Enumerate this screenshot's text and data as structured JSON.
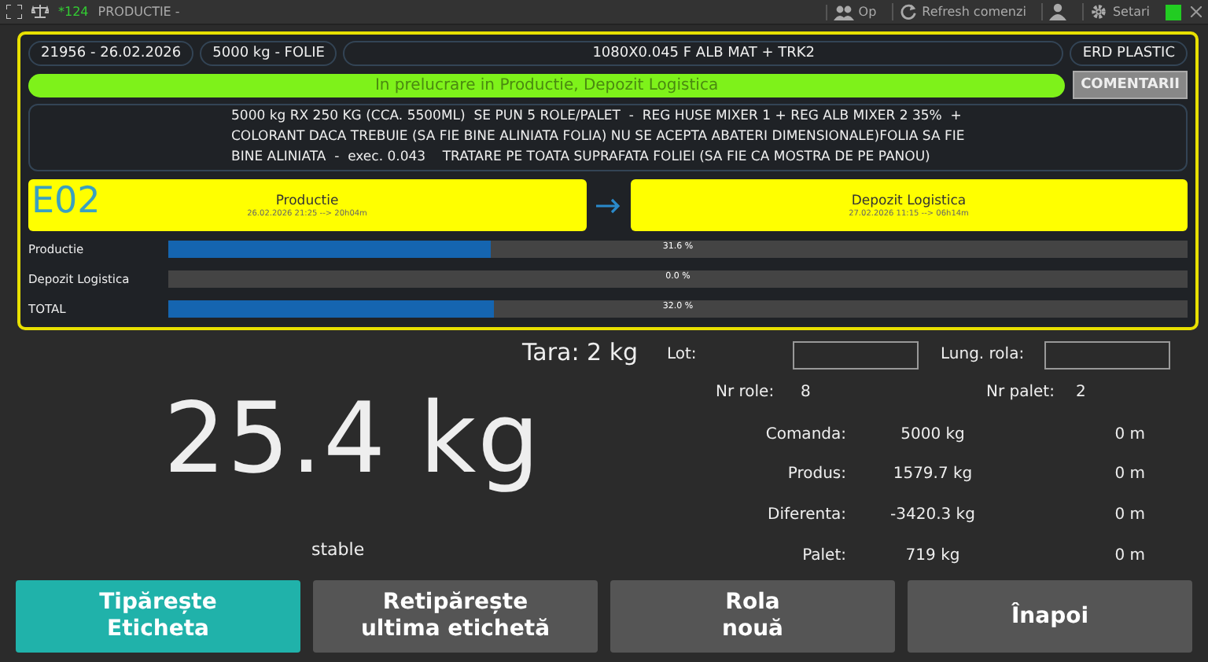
{
  "title_bar": {
    "counter": "*124",
    "title": "PRODUCTIE -",
    "items": [
      {
        "kind": "op",
        "label": "Op"
      },
      {
        "kind": "refresh",
        "label": "Refresh comenzi"
      },
      {
        "kind": "user"
      },
      {
        "kind": "settings",
        "label": "Setari"
      }
    ]
  },
  "order": {
    "number_date": "21956 - 26.02.2026",
    "quantity": "5000 kg - FOLIE",
    "product": "1080X0.045 F ALB MAT + TRK2",
    "client": "ERD PLASTIC",
    "status": "In prelucrare in Productie, Depozit Logistica",
    "comments_button": "COMENTARII",
    "notes": "5000 kg RX 250 KG (CCA. 5500ML)  SE PUN 5 ROLE/PALET  -  REG HUSE MIXER 1 + REG ALB MIXER 2 35%  +\nCOLORANT DACA TREBUIE (SA FIE BINE ALINIATA FOLIA) NU SE ACEPTA ABATERI DIMENSIONALE)FOLIA SA FIE\nBINE ALINIATA  -  exec. 0.043    TRATARE PE TOATA SUPRAFATA FOLIEI (SA FIE CA MOSTRA DE PE PANOU)"
  },
  "stages": {
    "machine": "E02",
    "steps": [
      {
        "name": "Productie",
        "time": "26.02.2026 21:25 --> 20h04m"
      },
      {
        "name": "Depozit Logistica",
        "time": "27.02.2026 11:15 --> 06h14m"
      }
    ]
  },
  "progress": [
    {
      "label": "Productie",
      "level": 0.316,
      "reading": "31.6 %"
    },
    {
      "label": "Depozit Logistica",
      "level": 0.0,
      "reading": "0.0 %"
    },
    {
      "label": "TOTAL",
      "level": 0.32,
      "reading": "32.0 %"
    }
  ],
  "scale": {
    "tare": "Tara: 2 kg",
    "weight": "25.4 kg",
    "state": "stable"
  },
  "fields": {
    "lot_label": "Lot:",
    "roll_length_label": "Lung. rola:",
    "rolls_label": "Nr role:",
    "rolls": "8",
    "pallet_label": "Nr palet:",
    "pallet": "2"
  },
  "totals": [
    {
      "label": "Comanda:",
      "kg": "5000 kg",
      "m": "0 m"
    },
    {
      "label": "Produs:",
      "kg": "1579.7 kg",
      "m": "0 m"
    },
    {
      "label": "Diferenta:",
      "kg": "-3420.3 kg",
      "m": "0 m"
    },
    {
      "label": "Palet:",
      "kg": "719 kg",
      "m": "0 m"
    }
  ],
  "buttons": [
    {
      "label": "Tipărește\nEticheta",
      "kind": "primary"
    },
    {
      "label": "Retipărește\nultima etichetă",
      "kind": "normal"
    },
    {
      "label": "Rola\nnouă",
      "kind": "normal"
    },
    {
      "label": "Înapoi",
      "kind": "normal"
    }
  ]
}
